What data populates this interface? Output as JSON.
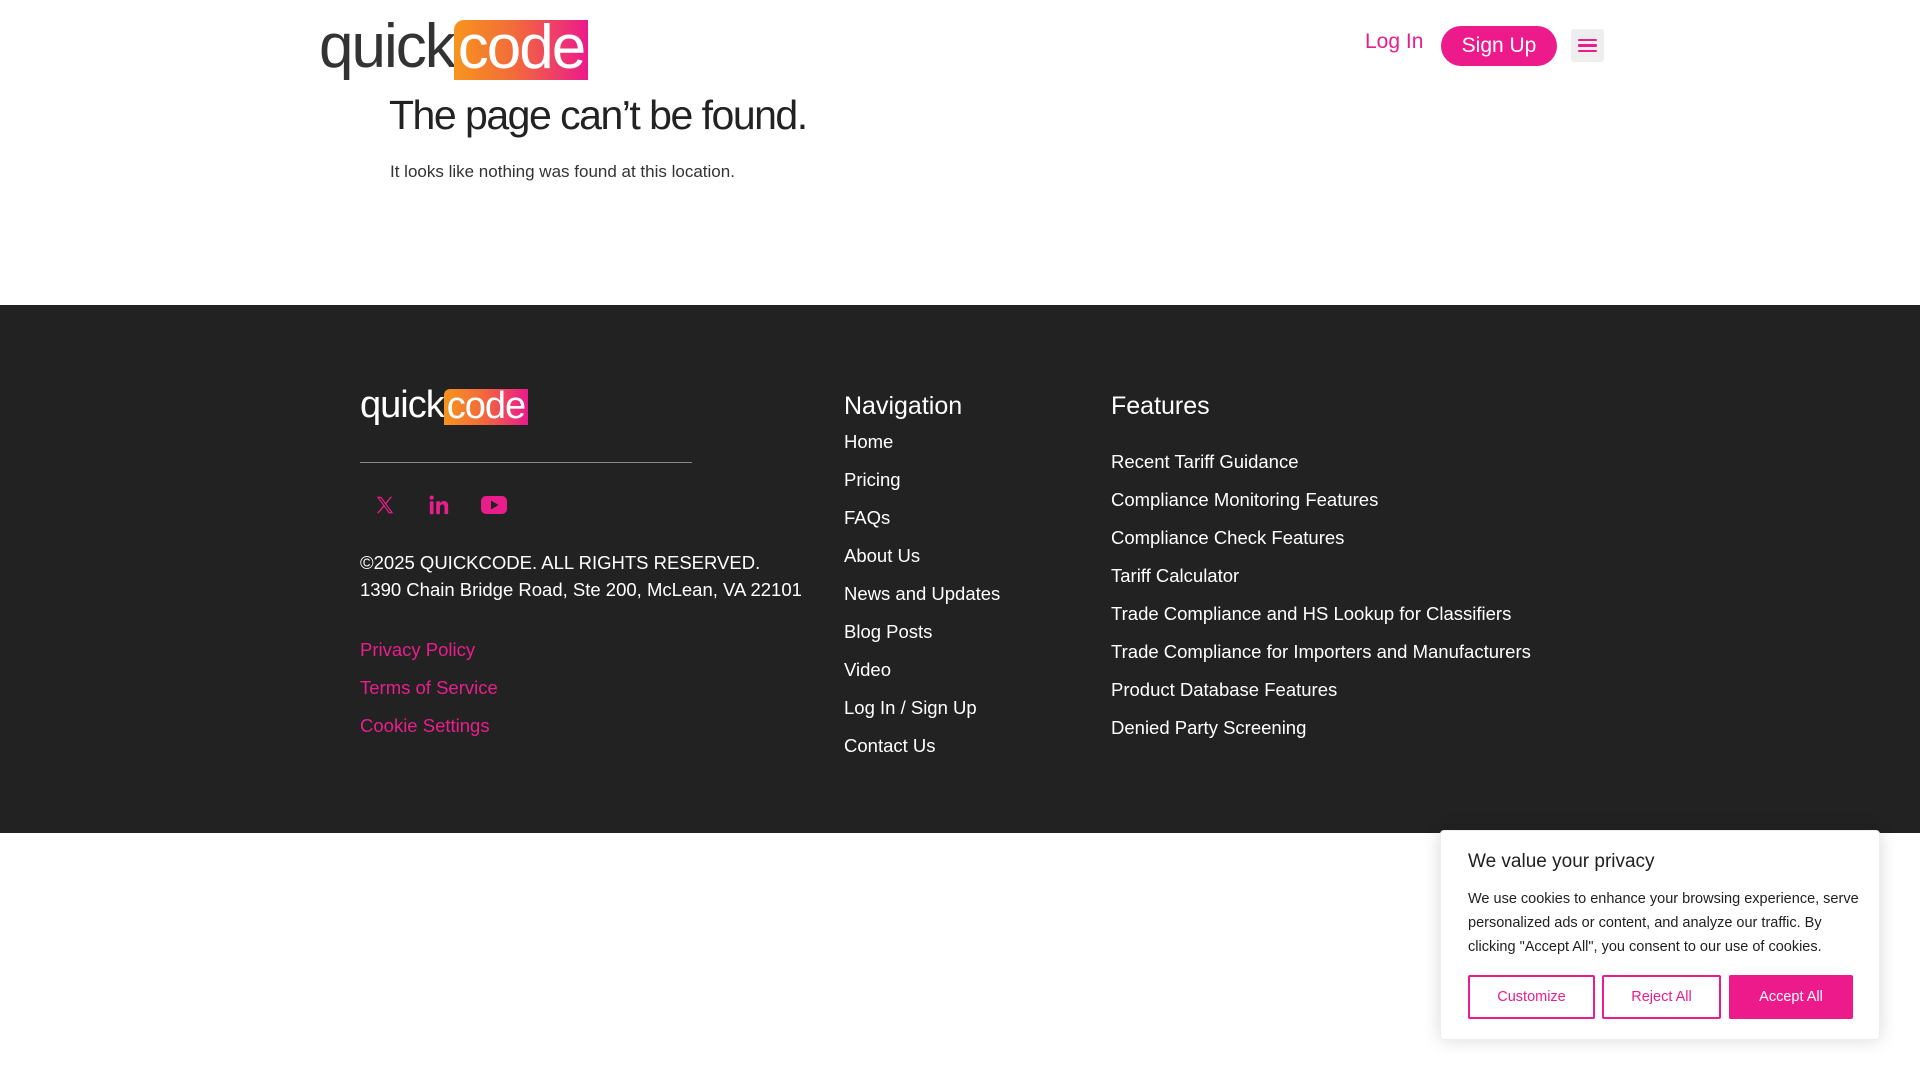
{
  "header": {
    "logo_quick": "quick",
    "logo_code": "code",
    "login_label": "Log In",
    "signup_label": "Sign Up",
    "menu_icon": "hamburger-menu-icon"
  },
  "main": {
    "title": "The page can’t be found.",
    "message": "It looks like nothing was found at this location."
  },
  "footer": {
    "logo_quick": "quick",
    "logo_code": "code",
    "social": [
      {
        "name": "x-twitter-icon"
      },
      {
        "name": "linkedin-icon"
      },
      {
        "name": "youtube-icon"
      }
    ],
    "copyright": "©2025 QUICKCODE. ALL RIGHTS RESERVED.",
    "address": "1390 Chain Bridge Road, Ste 200, McLean, VA 22101",
    "legal_links": [
      "Privacy Policy",
      "Terms of Service",
      "Cookie Settings"
    ],
    "navigation": {
      "heading": "Navigation",
      "links": [
        "Home",
        "Pricing",
        "FAQs",
        "About Us",
        "News and Updates",
        "Blog Posts",
        "Video",
        "Log In / Sign Up",
        "Contact Us"
      ]
    },
    "features": {
      "heading": "Features",
      "links": [
        "Recent Tariff Guidance",
        "Compliance Monitoring Features",
        "Compliance Check Features",
        "Tariff Calculator",
        "Trade Compliance and HS Lookup for Classifiers",
        "Trade Compliance for Importers and Manufacturers",
        "Product Database Features",
        "Denied Party Screening"
      ]
    }
  },
  "cookie_banner": {
    "title": "We value your privacy",
    "text": "We use cookies to enhance your browsing experience, serve personalized ads or content, and analyze our traffic. By clicking \"Accept All\", you consent to our use of cookies.",
    "customize_label": "Customize",
    "reject_label": "Reject All",
    "accept_label": "Accept All"
  },
  "colors": {
    "brand_pink": "#ec1a8b",
    "brand_orange": "#f7941d",
    "footer_bg": "#222222"
  }
}
